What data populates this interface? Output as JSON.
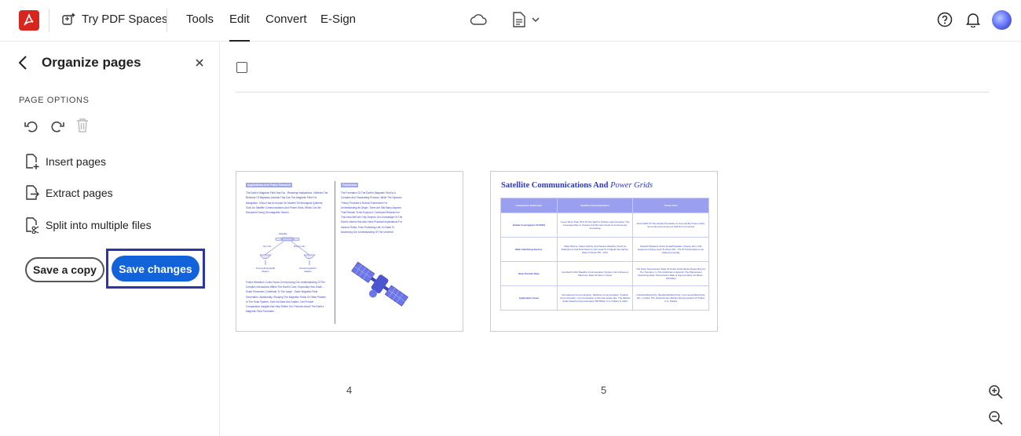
{
  "header": {
    "spaces_label": "Try PDF Spaces",
    "tabs": [
      {
        "label": "Tools"
      },
      {
        "label": "Edit"
      },
      {
        "label": "Convert"
      },
      {
        "label": "E-Sign"
      }
    ],
    "active_tab": "Edit"
  },
  "sidebar": {
    "title": "Organize pages",
    "section_label": "PAGE OPTIONS",
    "options": [
      {
        "label": "Insert pages"
      },
      {
        "label": "Extract pages"
      },
      {
        "label": "Split into multiple files"
      }
    ],
    "save_copy_label": "Save a copy",
    "save_changes_label": "Save changes"
  },
  "pages": [
    {
      "number": "4",
      "left_heading": "Applications And Future Research",
      "left_text": "The Earth's Magnetic Field Has Far - Reaching Implications. It Affects The Behavior Of Migratory Animals That Use The Magnetic Field For Navigation. It Also Has An Impact On Modern Technological Systems, Such As Satellite Communications And Power Grids, Which Can Be Disrupted During Geomagnetic Storms.",
      "diagram_labels": [
        "Satellite",
        "Up Link",
        "Down Link",
        "Transmitting Earth Station",
        "Receiving Earth Station"
      ],
      "left_text_2": "Future Research Could Focus On Improving Our Understanding Of The Complex Interactions Within The Earth's Core, Especially How Small - Scale Processes Contribute To The Large - Scale Magnetic Field Generation. Additionally, Studying The Magnetic Fields Of Other Planets In The Solar System, Such As Mars And Jupiter, Can Provide Comparative Insights And Help Refine Our Theories About The Earth's Magnetic Field Formation.",
      "right_heading": "Conclusion",
      "right_text": "The Formation Of The Earth's Magnetic Field Is A Complex And Fascinating Process. While The Dynamo Theory Provides A Robust Framework For Understanding Its Origin, There Are Still Many Aspects That Remain To Be Explored. Continued Research In This Area Will Not Only Deepen Our Knowledge Of The Earth's Interior But Also Have Practical Implications For Various Fields, From Protecting Life On Earth To Advancing Our Understanding Of The Universe."
    },
    {
      "number": "5",
      "title": "Satellite Communications And",
      "title_italic": "Power Grids",
      "table_headers": [
        "Comparison Dimension",
        "Satellite Communications",
        "Power Grid"
      ],
      "table_rows": [
        [
          "Global Coverage(As Of 2024)",
          "Cover More Than 70% Of The Earth's Surface Approximately, The Coverage Rate In Oceans And Remote Areas Is Continuously Increasing",
          "About 90% Of The Global Population Is Covered By Power Grids, Some Remote Areas Are Still Not Connected"
        ],
        [
          "Main Interfering Factors",
          "Solar Storms, Space Debris, And Severe Weather (Such As Rainstorms And Dust Storms) Can Lead To A Signal Interruption Rate Of About 5% - 10%",
          "Natural Disasters (Such As Earthquakes, Floods, Etc.) And Equipment Aging Lead To About 3% - 7% Of Transmission Line Failures Annually"
        ],
        [
          "Data Transfer Rate",
          "Low Earth Orbit Satellite Communication System Can Achieve A Maximum Rate Of About 1 Gbps",
          "The Data Transmission Rate Of Smart Grids Varies Depending On The Scenario. In The Distribution Network, The Mainstream Monitoring Data Transmission Rate Is Approximately 10 Mbps - 100 Mbps"
        ],
        [
          "Application Areas",
          "International Communication, Maritime Communication, Aviation Communication, Communication In Remote Areas, Etc. The Market Scale Reached Approximately 360 Billion U.S. Dollars In 2024",
          "Industrial Electricity, Residential Electricity, Commercial Electricity, Etc. In 2024, The Global Power Market Size Exceeded 10 Trillion U.S. Dollars"
        ]
      ]
    }
  ]
}
